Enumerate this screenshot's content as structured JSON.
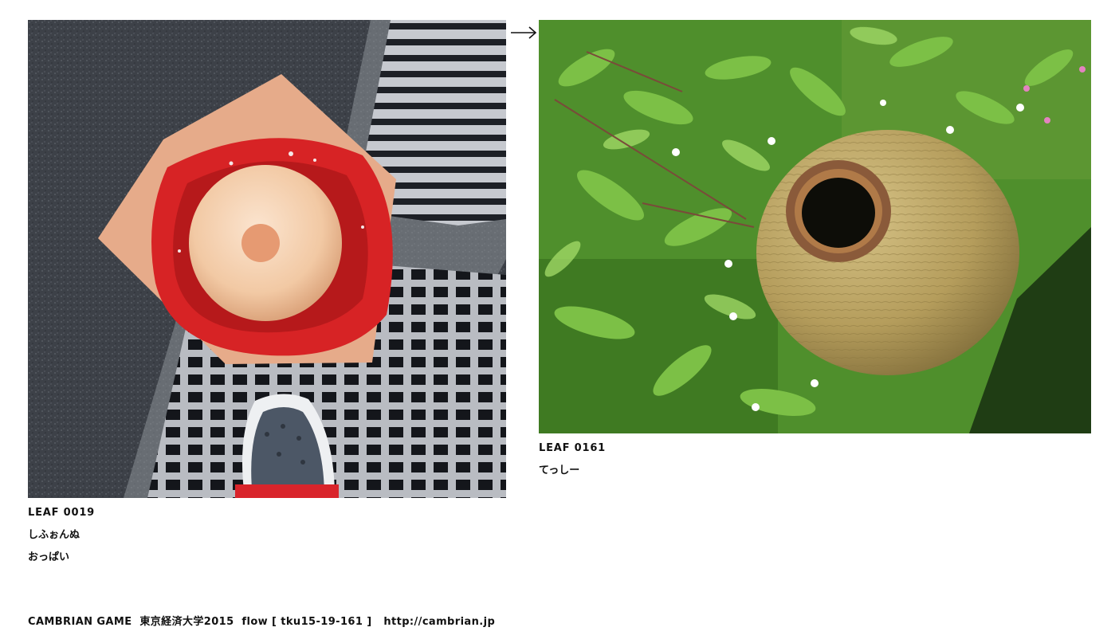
{
  "arrow": {
    "symbol": "→"
  },
  "leaves": [
    {
      "id": "LEAF 0019",
      "lines": [
        "しふぉんぬ",
        "おっぱい"
      ],
      "photo": "traffic-cone-on-drain-grate"
    },
    {
      "id": "LEAF 0161",
      "lines": [
        "てっしー"
      ],
      "photo": "clay-pot-in-grass"
    }
  ],
  "footer": {
    "project": "CAMBRIAN GAME",
    "school": "東京経済大学2015",
    "flow": "flow [ tku15-19-161 ]",
    "url": "http://cambrian.jp"
  }
}
